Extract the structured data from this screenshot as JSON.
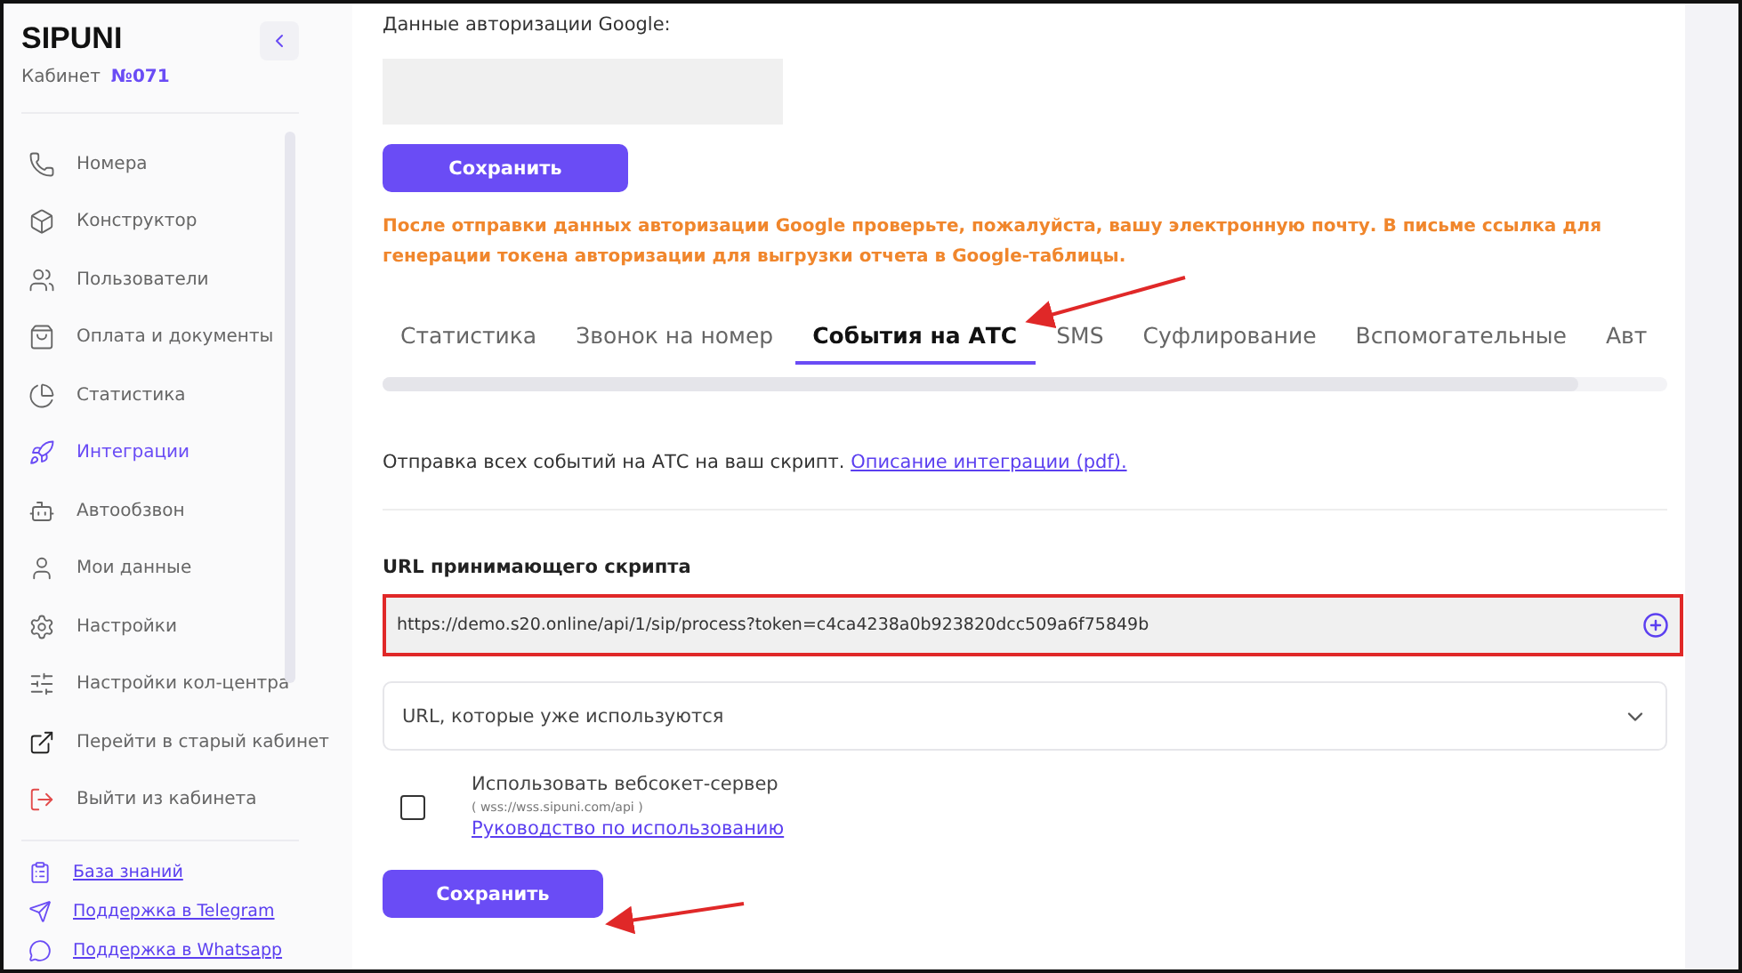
{
  "sidebar": {
    "logo": "SIPUNI",
    "cabinet_label": "Кабинет",
    "cabinet_number": "№071",
    "items": [
      {
        "label": "Номера",
        "selected": false
      },
      {
        "label": "Конструктор",
        "selected": false
      },
      {
        "label": "Пользователи",
        "selected": false
      },
      {
        "label": "Оплата и документы",
        "selected": false
      },
      {
        "label": "Статистика",
        "selected": false
      },
      {
        "label": "Интеграции",
        "selected": true
      },
      {
        "label": "Автообзвон",
        "selected": false
      },
      {
        "label": "Мои данные",
        "selected": false
      },
      {
        "label": "Настройки",
        "selected": false
      },
      {
        "label": "Настройки кол-центра",
        "selected": false
      },
      {
        "label": "Перейти в старый кабинет",
        "selected": false
      },
      {
        "label": "Выйти из кабинета",
        "selected": false
      }
    ],
    "links": [
      "База знаний",
      "Поддержка в Telegram",
      "Поддержка в Whatsapp"
    ]
  },
  "google": {
    "label": "Данные авторизации Google:",
    "save_button": "Сохранить",
    "notice": "После отправки данных авторизации Google проверьте, пожалуйста, вашу электронную почту. В письме ссылка для генерации токена авторизации для выгрузки отчета в Google-таблицы."
  },
  "tabs": [
    {
      "label": "Статистика",
      "selected": false
    },
    {
      "label": "Звонок на номер",
      "selected": false
    },
    {
      "label": "События на АТС",
      "selected": true
    },
    {
      "label": "SMS",
      "selected": false
    },
    {
      "label": "Суфлирование",
      "selected": false
    },
    {
      "label": "Вспомогательные",
      "selected": false
    },
    {
      "label": "Авт",
      "selected": false
    }
  ],
  "events": {
    "description": "Отправка всех событий на АТС на ваш скрипт.",
    "description_link": "Описание интеграции (pdf).",
    "url_label": "URL принимающего скрипта",
    "url_value": "https://demo.s20.online/api/1/sip/process?token=c4ca4238a0b923820dcc509a6f75849b",
    "used_urls": {
      "label": "URL, которые уже используются",
      "expanded": false
    },
    "websocket": {
      "label": "Использовать вебсокет-сервер",
      "hint": "( wss://wss.sipuni.com/api )",
      "link": "Руководство по использованию",
      "checked": false
    },
    "save_button": "Сохранить"
  }
}
